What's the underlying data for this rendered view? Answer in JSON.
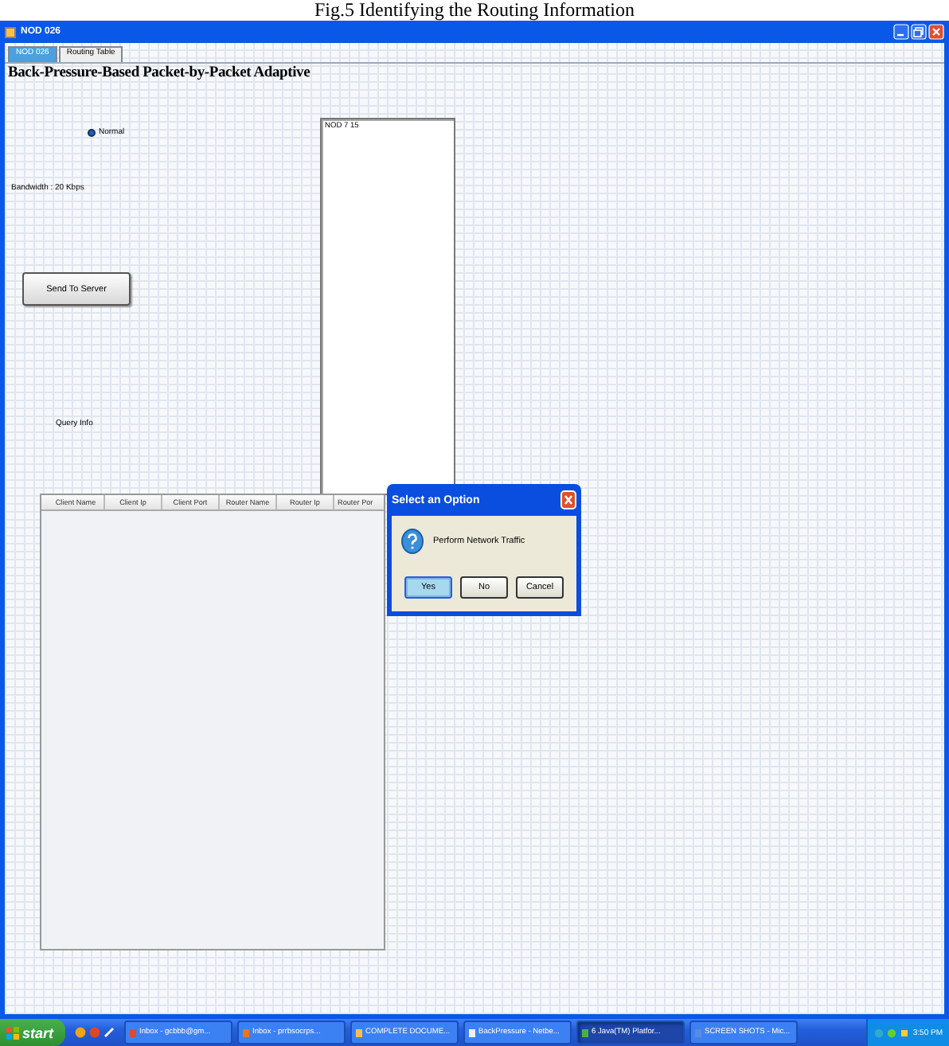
{
  "caption": "Fig.5 Identifying the Routing Information",
  "window": {
    "title": "NOD 026"
  },
  "tabs": [
    {
      "label": "NOD 026",
      "selected": true
    },
    {
      "label": "Routing Table",
      "selected": false
    }
  ],
  "heading": "Back-Pressure-Based Packet-by-Packet Adaptive",
  "options": [
    {
      "label": "Normal",
      "selected": true
    }
  ],
  "bandwidth": "Bandwidth : 20 Kbps",
  "send_button": "Send To Server",
  "log_box": {
    "value": "NOD 7 15"
  },
  "query_label": "Query Info",
  "table": {
    "columns": [
      "Client Name",
      "Client Ip",
      "Client Port",
      "Router Name",
      "Router Ip",
      "Router Por"
    ]
  },
  "dialog": {
    "title": "Select an Option",
    "message": "Perform Network Traffic",
    "buttons": [
      {
        "label": "Yes",
        "selected": true
      },
      {
        "label": "No",
        "selected": false
      },
      {
        "label": "Cancel",
        "selected": false
      }
    ]
  },
  "taskbar": {
    "start": "start",
    "tasks": [
      {
        "label": "Inbox - gcbbb@gm...",
        "active": false
      },
      {
        "label": "Inbox - prrbsocrps...",
        "active": false
      },
      {
        "label": "COMPLETE DOCUME...",
        "active": false
      },
      {
        "label": "BackPressure - Netbe...",
        "active": false
      },
      {
        "label": "6 Java(TM) Platfor...",
        "active": true
      },
      {
        "label": "SCREEN SHOTS - Mic...",
        "active": false
      }
    ],
    "clock": "3:50 PM"
  }
}
